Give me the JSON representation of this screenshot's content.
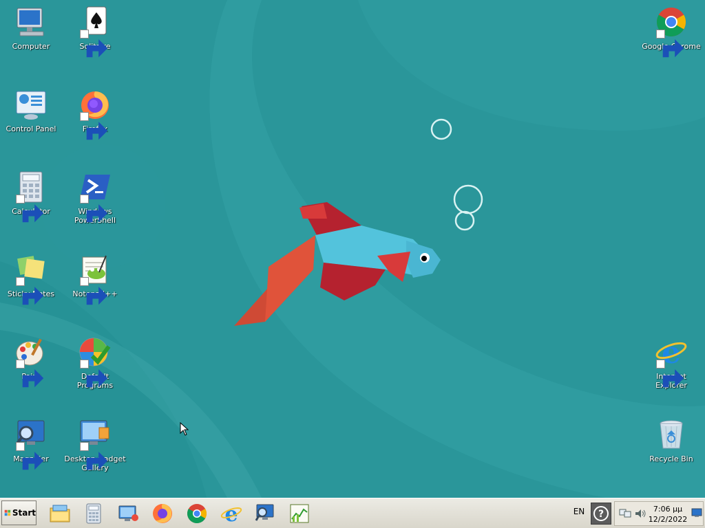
{
  "desktop": {
    "icons": [
      {
        "label": "Computer",
        "icon": "computer-icon"
      },
      {
        "label": "Solitaire",
        "icon": "solitaire-icon"
      },
      {
        "label": "Google Chrome",
        "icon": "chrome-icon"
      },
      {
        "label": "Control Panel",
        "icon": "control-panel-icon"
      },
      {
        "label": "Firefox",
        "icon": "firefox-icon"
      },
      {
        "label": "Calculator",
        "icon": "calculator-icon"
      },
      {
        "label": "Windows PowerShell",
        "icon": "powershell-icon"
      },
      {
        "label": "Sticky Notes",
        "icon": "sticky-notes-icon"
      },
      {
        "label": "Notepad++",
        "icon": "notepadpp-icon"
      },
      {
        "label": "Paint",
        "icon": "paint-icon"
      },
      {
        "label": "Default Programs",
        "icon": "default-programs-icon"
      },
      {
        "label": "Internet Explorer",
        "icon": "internet-explorer-icon"
      },
      {
        "label": "Magnifier",
        "icon": "magnifier-icon"
      },
      {
        "label": "Desktop Gadget Gallery",
        "icon": "gadget-gallery-icon"
      },
      {
        "label": "Recycle Bin",
        "icon": "recycle-bin-icon"
      }
    ],
    "wallpaper": "betta-fish-wallpaper"
  },
  "taskbar": {
    "start_label": "Start",
    "pinned": [
      "file-explorer-icon",
      "calculator-icon",
      "remote-desktop-icon",
      "firefox-icon",
      "chrome-icon",
      "internet-explorer-icon",
      "magnifier-icon",
      "chart-app-icon"
    ],
    "language": "EN",
    "clock": {
      "time": "7:06 μμ",
      "date": "12/2/2022"
    }
  },
  "colors": {
    "desktop_bg": "#2a969a",
    "taskbar_bg": "#e3e1d9"
  }
}
